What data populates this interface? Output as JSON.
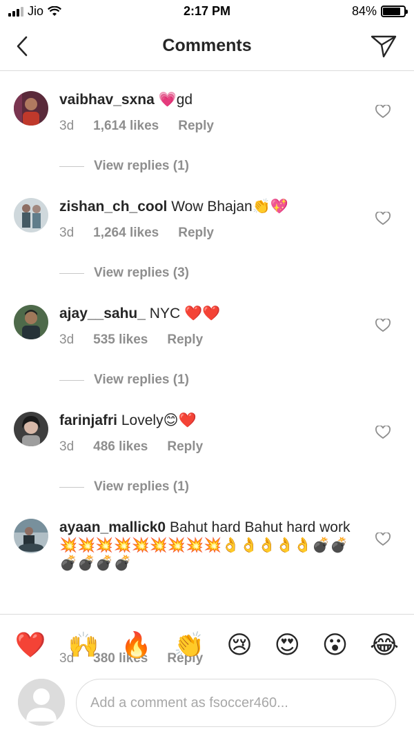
{
  "status_bar": {
    "carrier": "Jio",
    "time": "2:17 PM",
    "battery": "84%",
    "battery_level": 0.84
  },
  "header": {
    "title": "Comments",
    "back_icon": "chevron-left-icon",
    "send_icon": "paper-plane-icon"
  },
  "comments": [
    {
      "username": "vaibhav_sxna",
      "text": " 💗gd",
      "time": "3d",
      "likes": "1,614 likes",
      "reply": "Reply",
      "view_replies": "View replies (1)"
    },
    {
      "username": "zishan_ch_cool",
      "text": " Wow Bhajan👏💖",
      "time": "3d",
      "likes": "1,264 likes",
      "reply": "Reply",
      "view_replies": "View replies (3)"
    },
    {
      "username": "ajay__sahu_",
      "text": " NYC ❤️❤️",
      "time": "3d",
      "likes": "535 likes",
      "reply": "Reply",
      "view_replies": "View replies (1)"
    },
    {
      "username": "farinjafri",
      "text": " Lovely😊❤️",
      "time": "3d",
      "likes": "486 likes",
      "reply": "Reply",
      "view_replies": "View replies (1)"
    },
    {
      "username": "ayaan_mallick0",
      "text": " Bahut hard Bahut hard work 💥💥💥💥💥💥💥💥💥👌👌👌👌👌💣💣💣💣💣💣",
      "time": "3d",
      "likes": "380 likes",
      "reply": "Reply"
    }
  ],
  "emoji_bar": [
    "❤️",
    "🙌",
    "🔥",
    "👏",
    "😢",
    "😍",
    "😮",
    "😂"
  ],
  "input": {
    "placeholder": "Add a comment as fsoccer460..."
  },
  "colors": {
    "text": "#262626",
    "secondary": "#8e8e8e",
    "divider": "#dbdbdb"
  }
}
